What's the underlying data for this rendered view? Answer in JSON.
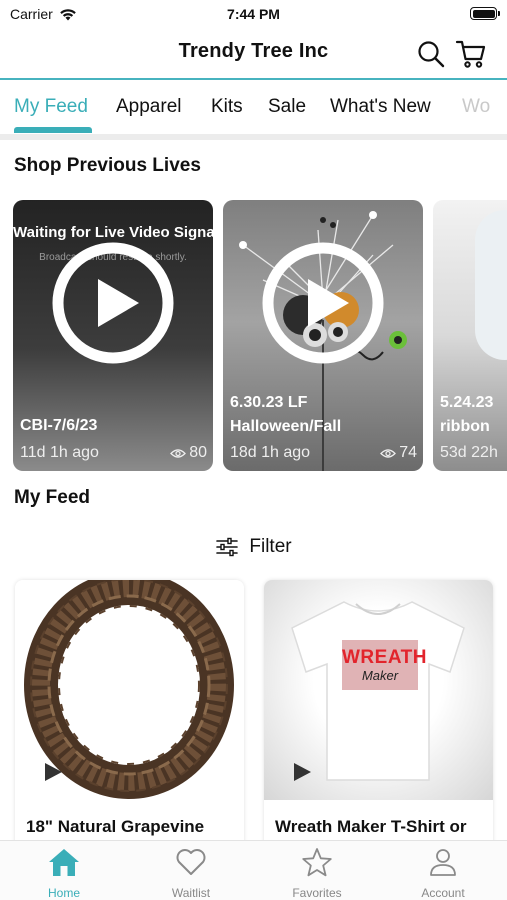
{
  "status_bar": {
    "carrier": "Carrier",
    "time": "7:44 PM"
  },
  "header": {
    "title": "Trendy Tree Inc",
    "search_icon": "search-icon",
    "cart_icon": "cart-icon"
  },
  "tabs": [
    {
      "label": "My Feed",
      "active": true
    },
    {
      "label": "Apparel"
    },
    {
      "label": "Kits"
    },
    {
      "label": "Sale"
    },
    {
      "label": "What's New"
    },
    {
      "label": "Wo"
    }
  ],
  "shop_previous_lives": {
    "title": "Shop Previous Lives",
    "cards": [
      {
        "overlay_text": "Waiting for Live Video Signal",
        "overlay_subtext": "Broadcast should resume shortly.",
        "title_line1": "CBI-7/6/23",
        "title_line2": "",
        "age": "11d 1h ago",
        "views": "80"
      },
      {
        "title_line1": "6.30.23 LF",
        "title_line2": "Halloween/Fall",
        "age": "18d 1h ago",
        "views": "74"
      },
      {
        "title_line1": "5.24.23",
        "title_line2": "ribbon",
        "age": "53d 22h"
      }
    ]
  },
  "my_feed": {
    "title": "My Feed",
    "filter_label": "Filter",
    "products": [
      {
        "name": "18\" Natural Grapevine"
      },
      {
        "name": "Wreath Maker T-Shirt or",
        "shirt_text_1": "WREATH",
        "shirt_text_2": "Maker"
      }
    ]
  },
  "bottom_nav": [
    {
      "label": "Home",
      "icon": "home-icon",
      "active": true
    },
    {
      "label": "Waitlist",
      "icon": "heart-icon"
    },
    {
      "label": "Favorites",
      "icon": "star-icon"
    },
    {
      "label": "Account",
      "icon": "person-icon"
    }
  ],
  "colors": {
    "accent": "#3aaeb8",
    "header_line": "#47b3bf"
  }
}
